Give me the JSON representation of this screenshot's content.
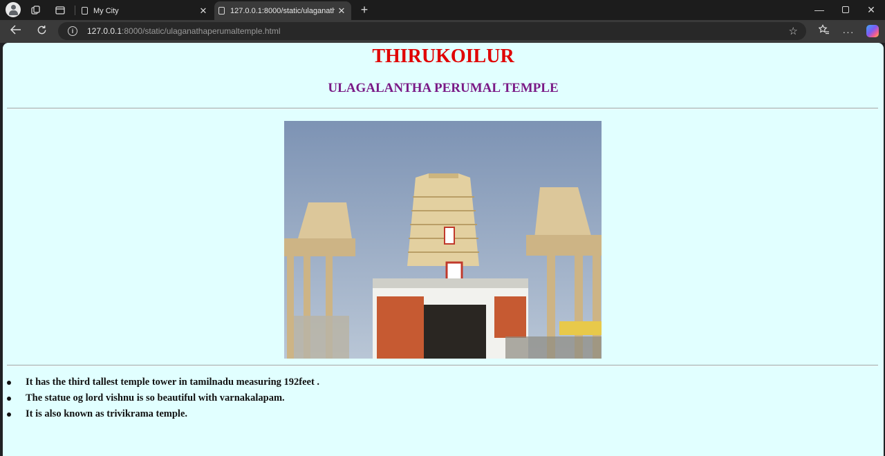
{
  "browser": {
    "tabs": [
      {
        "title": "My City",
        "close": "✕"
      },
      {
        "title": "127.0.0.1:8000/static/ulaganathap",
        "close": "✕"
      }
    ],
    "new_tab": "+",
    "window": {
      "minimize": "—",
      "close": "✕"
    },
    "address": {
      "host": "127.0.0.1",
      "rest": ":8000/static/ulaganathaperumaltemple.html"
    },
    "more": "···"
  },
  "page": {
    "background": "#e1ffff",
    "title": "THIRUKOILUR",
    "subtitle": "ULAGALANTHA PERUMAL TEMPLE",
    "bullets": [
      "It has the third tallest temple tower in tamilnadu measuring 192feet .",
      "The statue og lord vishnu is so beautiful with varnakalapam.",
      "It is also known as trivikrama temple."
    ]
  }
}
